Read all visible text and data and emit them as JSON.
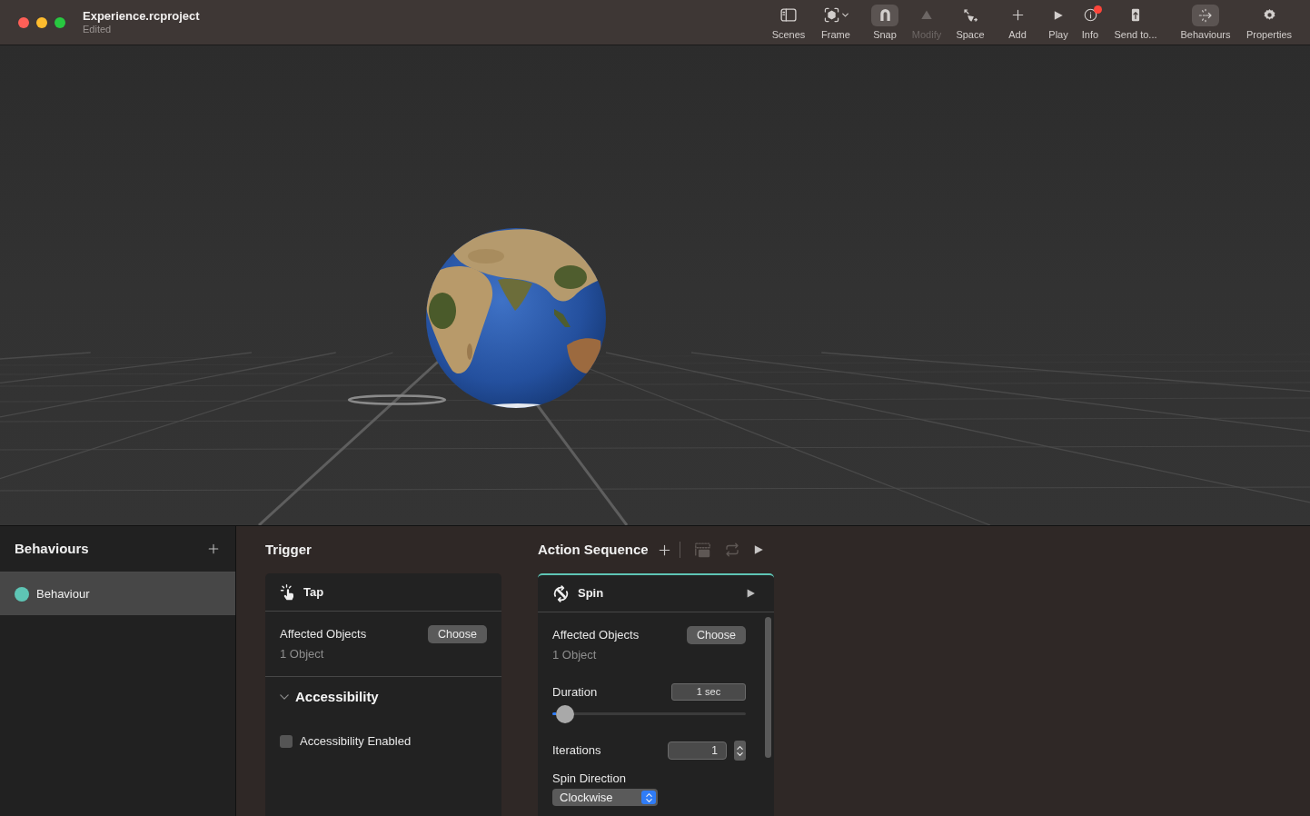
{
  "window": {
    "title": "Experience.rcproject",
    "subtitle": "Edited"
  },
  "toolbar": [
    {
      "label": "Scenes",
      "selected": false,
      "disabled": false,
      "has_menu": false,
      "badge": false
    },
    {
      "label": "Frame",
      "selected": false,
      "disabled": false,
      "has_menu": true,
      "badge": false
    },
    {
      "label": "Snap",
      "selected": true,
      "disabled": false,
      "has_menu": false,
      "badge": false
    },
    {
      "label": "Modify",
      "selected": false,
      "disabled": true,
      "has_menu": false,
      "badge": false
    },
    {
      "label": "Space",
      "selected": false,
      "disabled": false,
      "has_menu": false,
      "badge": false
    },
    {
      "label": "Add",
      "selected": false,
      "disabled": false,
      "has_menu": false,
      "badge": false
    },
    {
      "label": "Play",
      "selected": false,
      "disabled": false,
      "has_menu": false,
      "badge": false
    },
    {
      "label": "Info",
      "selected": false,
      "disabled": false,
      "has_menu": false,
      "badge": true
    },
    {
      "label": "Send to...",
      "selected": false,
      "disabled": false,
      "has_menu": false,
      "badge": false
    },
    {
      "label": "Behaviours",
      "selected": true,
      "disabled": false,
      "has_menu": false,
      "badge": false
    },
    {
      "label": "Properties",
      "selected": false,
      "disabled": false,
      "has_menu": false,
      "badge": false
    }
  ],
  "behaviours": {
    "title": "Behaviours",
    "items": [
      {
        "name": "Behaviour",
        "color": "#5ec5b5",
        "selected": true
      }
    ]
  },
  "trigger": {
    "title": "Trigger",
    "card": {
      "name": "Tap",
      "affected_label": "Affected Objects",
      "affected_value": "1 Object",
      "choose_button": "Choose",
      "accessibility": {
        "title": "Accessibility",
        "expanded": true,
        "checkbox": {
          "label": "Accessibility Enabled",
          "checked": false
        }
      }
    }
  },
  "action_sequence": {
    "title": "Action Sequence",
    "tools": [
      {
        "disabled": false
      },
      {
        "disabled": true
      },
      {
        "disabled": true
      },
      {
        "disabled": false
      }
    ],
    "actions": [
      {
        "name": "Spin",
        "selected": true,
        "affected_label": "Affected Objects",
        "affected_value": "1 Object",
        "choose_button": "Choose",
        "duration": {
          "label": "Duration",
          "value": "1 sec",
          "level": 0.02
        },
        "iterations": {
          "label": "Iterations",
          "value": "1"
        },
        "spin_direction": {
          "label": "Spin Direction",
          "value": "Clockwise"
        }
      }
    ]
  }
}
